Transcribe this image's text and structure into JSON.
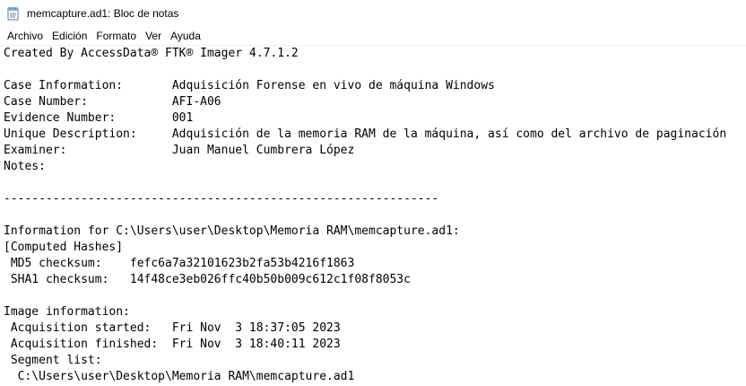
{
  "window": {
    "title": "memcapture.ad1: Bloc de notas"
  },
  "menu": {
    "items": [
      "Archivo",
      "Edición",
      "Formato",
      "Ver",
      "Ayuda"
    ]
  },
  "editor": {
    "lines": [
      "Created By AccessData® FTK® Imager 4.7.1.2",
      "",
      "Case Information:       Adquisición Forense en vivo de máquina Windows",
      "Case Number:            AFI-A06",
      "Evidence Number:        001",
      "Unique Description:     Adquisición de la memoria RAM de la máquina, así como del archivo de paginación",
      "Examiner:               Juan Manuel Cumbrera López",
      "Notes:",
      "",
      "--------------------------------------------------------------",
      "",
      "Information for C:\\Users\\user\\Desktop\\Memoria RAM\\memcapture.ad1:",
      "[Computed Hashes]",
      " MD5 checksum:    fefc6a7a32101623b2fa53b4216f1863",
      " SHA1 checksum:   14f48ce3eb026ffc40b50b009c612c1f08f8053c",
      "",
      "Image information:",
      " Acquisition started:   Fri Nov  3 18:37:05 2023",
      " Acquisition finished:  Fri Nov  3 18:40:11 2023",
      " Segment list:",
      "  C:\\Users\\user\\Desktop\\Memoria RAM\\memcapture.ad1"
    ]
  }
}
